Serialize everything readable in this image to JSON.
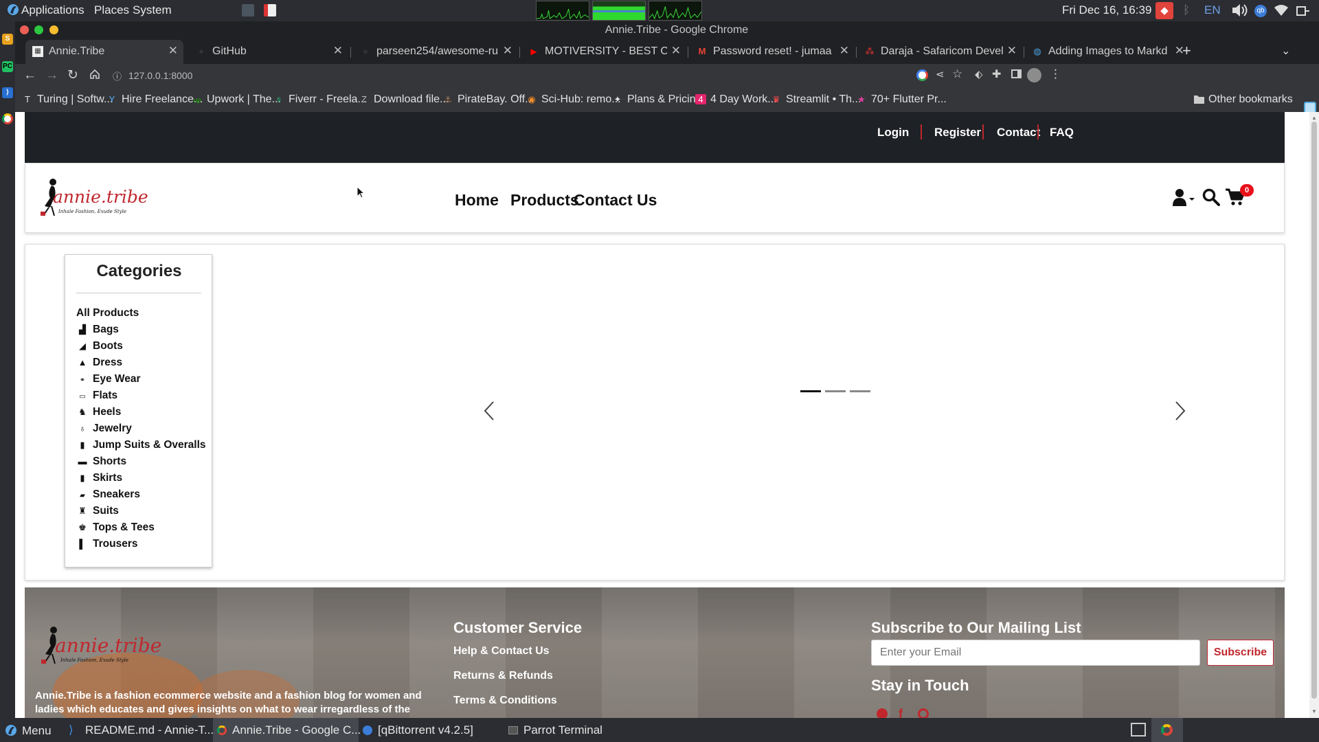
{
  "system_panel": {
    "menu_items": [
      "Applications",
      "Places",
      "System"
    ],
    "clock": "Fri Dec 16, 16:39",
    "language": "EN"
  },
  "browser": {
    "window_title": "Annie.Tribe - Google Chrome",
    "tabs": [
      {
        "title": "Annie.Tribe",
        "active": true
      },
      {
        "title": "GitHub"
      },
      {
        "title": "parseen254/awesome-ru"
      },
      {
        "title": "MOTIVERSITY - BEST C"
      },
      {
        "title": "Password reset! - jumaa"
      },
      {
        "title": "Daraja - Safaricom Devel"
      },
      {
        "title": "Adding Images to Markd"
      }
    ],
    "new_tab": "+",
    "url": "127.0.0.1:8000",
    "bookmarks": [
      {
        "label": "Turing | Softw...",
        "icon": "T"
      },
      {
        "label": "Hire Freelance...",
        "icon": "Y"
      },
      {
        "label": "Upwork | The...",
        "icon": "up"
      },
      {
        "label": "Fiverr - Freela...",
        "icon": "fi"
      },
      {
        "label": "Download file...",
        "icon": "Z"
      },
      {
        "label": "PirateBay. Off...",
        "icon": "⚓"
      },
      {
        "label": "Sci-Hub: remo...",
        "icon": "◉"
      },
      {
        "label": "Plans & Pricin...",
        "icon": "✦"
      },
      {
        "label": "4 Day Work...",
        "icon": "4"
      },
      {
        "label": "Streamlit • Th...",
        "icon": "♛"
      },
      {
        "label": "70+ Flutter Pr...",
        "icon": "★"
      }
    ],
    "other_bookmarks": "Other bookmarks"
  },
  "site": {
    "top_links": [
      "Login",
      "Register",
      "Contact",
      "FAQ"
    ],
    "logo_text": "annie.tribe",
    "logo_tagline": "Inhale Fashion, Exude Style",
    "nav": [
      "Home",
      "Products",
      "Contact Us"
    ],
    "cart_count": "0",
    "categories_title": "Categories",
    "categories": [
      {
        "label": "All Products",
        "icon": ""
      },
      {
        "label": "Bags",
        "icon": "bag-icon"
      },
      {
        "label": "Boots",
        "icon": "boot-icon"
      },
      {
        "label": "Dress",
        "icon": "dress-icon"
      },
      {
        "label": "Eye Wear",
        "icon": "glasses-icon"
      },
      {
        "label": "Flats",
        "icon": "flats-icon"
      },
      {
        "label": "Heels",
        "icon": "heel-icon"
      },
      {
        "label": "Jewelry",
        "icon": "ring-icon"
      },
      {
        "label": "Jump Suits & Overalls",
        "icon": "jumpsuit-icon"
      },
      {
        "label": "Shorts",
        "icon": "shorts-icon"
      },
      {
        "label": "Skirts",
        "icon": "skirt-icon"
      },
      {
        "label": "Sneakers",
        "icon": "sneaker-icon"
      },
      {
        "label": "Suits",
        "icon": "suit-icon"
      },
      {
        "label": "Tops & Tees",
        "icon": "shirt-icon"
      },
      {
        "label": "Trousers",
        "icon": "trousers-icon"
      }
    ],
    "carousel_slides": 3,
    "footer": {
      "about": "Annie.Tribe is a fashion ecommerce website and a fashion blog for women and ladies which educates and gives insights on what to wear irregardless of the",
      "customer_service_title": "Customer Service",
      "customer_links": [
        "Help & Contact Us",
        "Returns & Refunds",
        "Terms & Conditions"
      ],
      "subscribe_title": "Subscribe to Our Mailing List",
      "email_placeholder": "Enter your Email",
      "subscribe_button": "Subscribe",
      "stay_in_touch": "Stay in Touch"
    }
  },
  "taskbar": {
    "menu": "Menu",
    "items": [
      {
        "label": "README.md - Annie-T..."
      },
      {
        "label": "Annie.Tribe - Google C...",
        "active": true
      },
      {
        "label": "[qBittorrent v4.2.5]"
      },
      {
        "label": "Parrot Terminal"
      }
    ]
  },
  "colors": {
    "accent_red": "#c0272d",
    "dark_strip": "#1e2125",
    "panel_bg": "#2b2d32"
  }
}
